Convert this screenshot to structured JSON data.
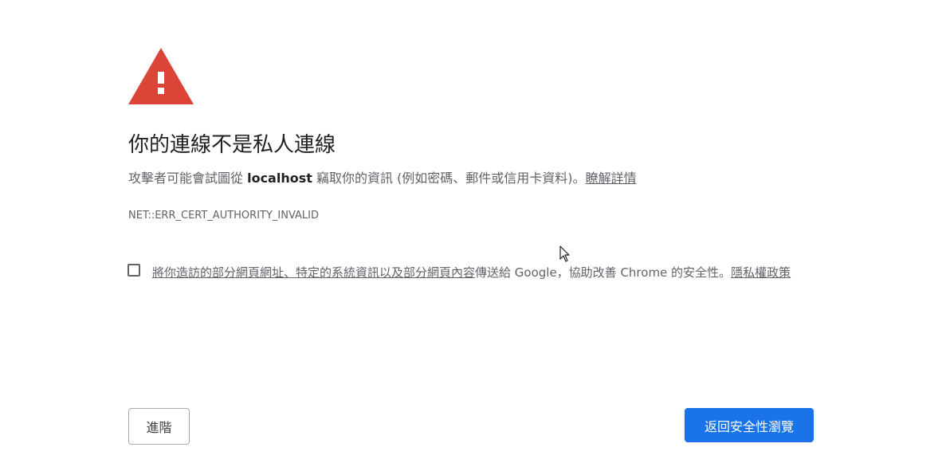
{
  "icons": {
    "warning": "warning-triangle-icon",
    "cursor": "mouse-cursor-icon"
  },
  "colors": {
    "warning_red": "#db4437",
    "primary_blue": "#1a73e8",
    "title_text": "#202124",
    "secondary_text": "#5f6368"
  },
  "heading": {
    "title": "你的連線不是私人連線"
  },
  "description": {
    "prefix": "攻擊者可能會試圖從 ",
    "host": "localhost",
    "suffix": " 竊取你的資訊 (例如密碼、郵件或信用卡資料)。",
    "learn_more_link": "瞭解詳情"
  },
  "error": {
    "code": "NET::ERR_CERT_AUTHORITY_INVALID"
  },
  "report": {
    "checked": false,
    "link_text": "將你造訪的部分網頁網址、特定的系統資訊以及部分網頁內容",
    "middle_text": "傳送給 Google，協助改善 Chrome 的安全性。",
    "privacy_link": "隱私權政策"
  },
  "buttons": {
    "advanced": "進階",
    "back_to_safety": "返回安全性瀏覽"
  }
}
